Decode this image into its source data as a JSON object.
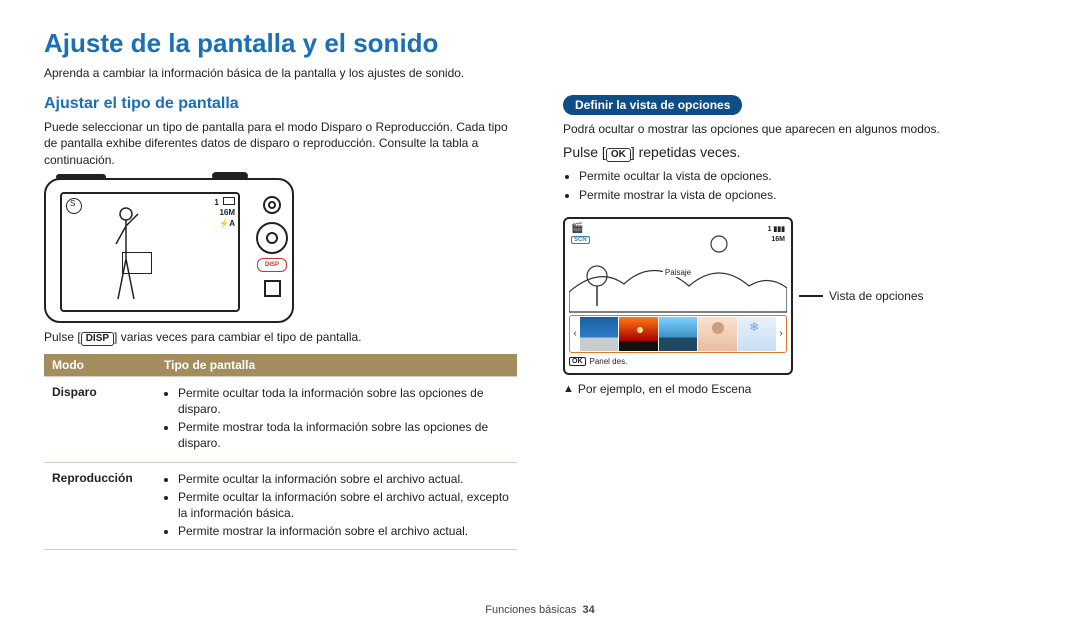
{
  "title": "Ajuste de la pantalla y el sonido",
  "intro": "Aprenda a cambiar la información básica de la pantalla y los ajustes de sonido.",
  "left": {
    "heading": "Ajustar el tipo de pantalla",
    "desc": "Puede seleccionar un tipo de pantalla para el modo Disparo o Reproducción. Cada tipo de pantalla exhibe diferentes datos de disparo o reproducción. Consulte la tabla a continuación.",
    "disp_btn": "DISP",
    "disp_text_prefix": "Pulse [",
    "disp_text_suffix": "] varias veces para cambiar el tipo de pantalla.",
    "disp_on_camera": "DISP",
    "screen_top_right_1": "1",
    "screen_res": "16M",
    "screen_flash": "⚡A",
    "table": {
      "h1": "Modo",
      "h2": "Tipo de pantalla",
      "r1_mode": "Disparo",
      "r1_i1": "Permite ocultar toda la información sobre las opciones de disparo.",
      "r1_i2": "Permite mostrar toda la información sobre las opciones de disparo.",
      "r2_mode": "Reproducción",
      "r2_i1": "Permite ocultar la información sobre el archivo actual.",
      "r2_i2": "Permite ocultar la información sobre el archivo actual, excepto la información básica.",
      "r2_i3": "Permite mostrar la información sobre el archivo actual."
    }
  },
  "right": {
    "pill": "Definir la vista de opciones",
    "desc": "Podrá ocultar o mostrar las opciones que aparecen en algunos modos.",
    "press_prefix": "Pulse [",
    "ok_label": "OK",
    "press_suffix": "] repetidas veces.",
    "b1": "Permite ocultar la vista de opciones.",
    "b2": "Permite mostrar la vista de opciones.",
    "scene": {
      "scn": "SCN",
      "tr_1": "1",
      "tr_res": "16M",
      "paisaje": "Paisaje",
      "panel_ok": "OK",
      "panel_label": "Panel des."
    },
    "vista_label": "Vista de opciones",
    "example": "Por ejemplo, en el modo Escena"
  },
  "footer": {
    "section": "Funciones básicas",
    "page": "34"
  }
}
